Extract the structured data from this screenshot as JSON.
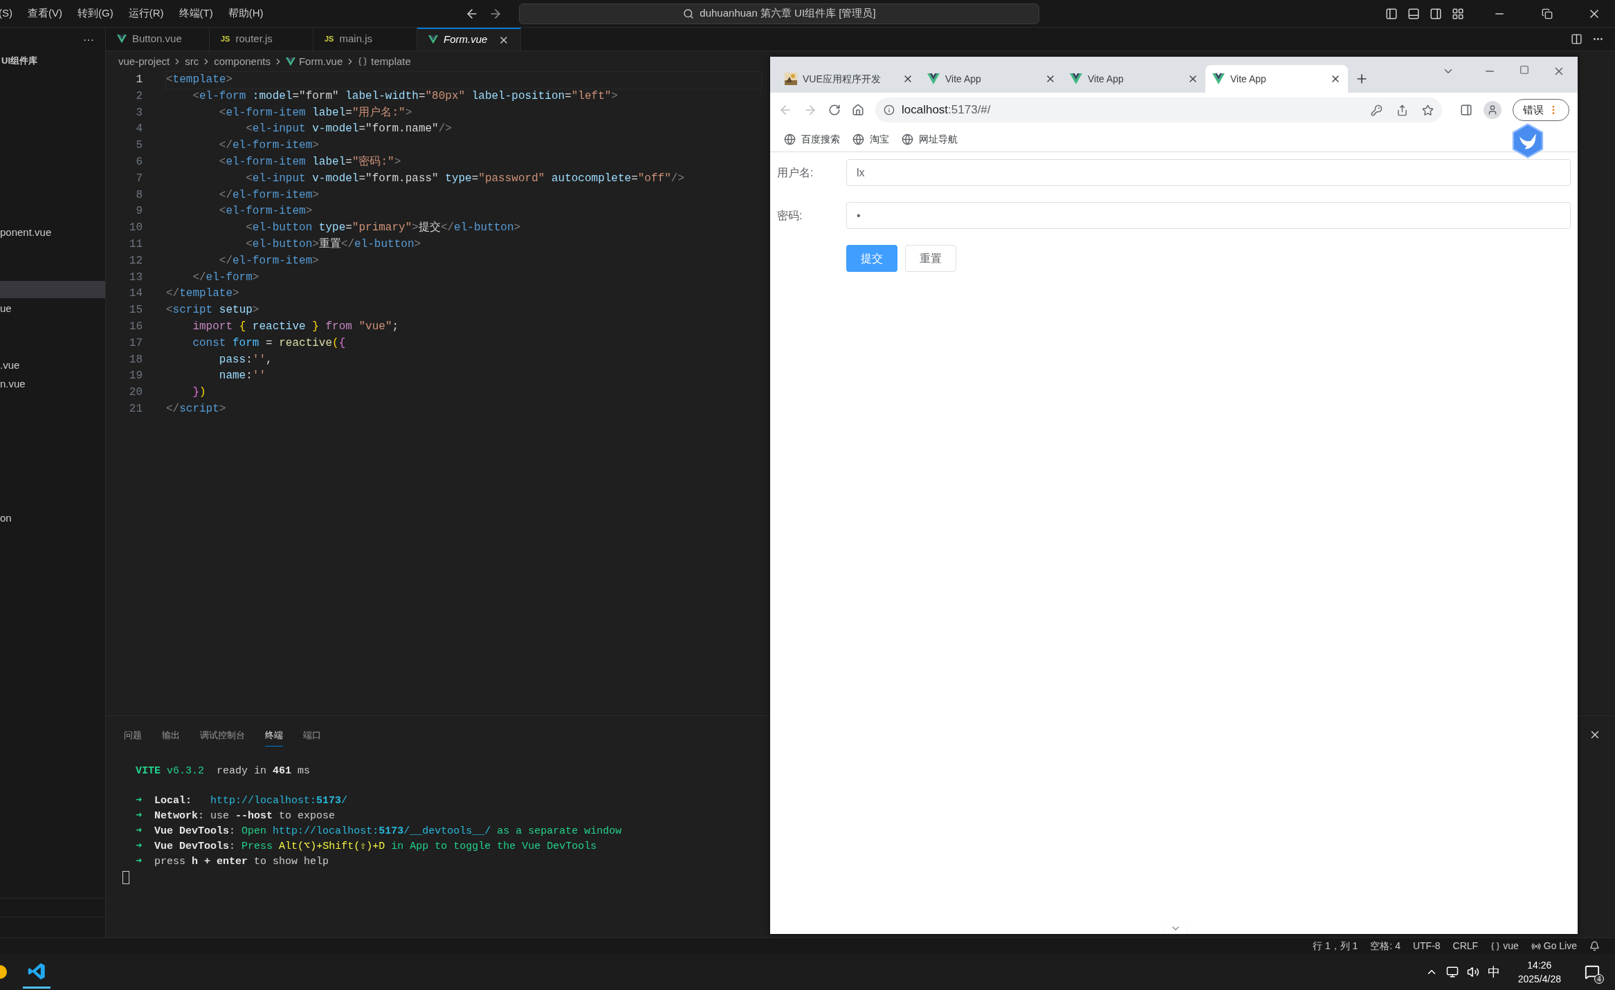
{
  "title_bar": {
    "menus": [
      "(S)",
      "查看(V)",
      "转到(G)",
      "运行(R)",
      "终端(T)",
      "帮助(H)"
    ],
    "search": "duhuanhuan 第六章 UI组件库 [管理员]"
  },
  "sidebar": {
    "more": "···",
    "title": "UI组件库",
    "items": [
      "ponent.vue",
      "ue",
      ".vue",
      "n.vue",
      "on"
    ]
  },
  "editor_tabs": [
    {
      "label": "Button.vue",
      "kind": "vue",
      "selected": false
    },
    {
      "label": "router.js",
      "kind": "js",
      "badge": "JS",
      "selected": false
    },
    {
      "label": "main.js",
      "kind": "js",
      "badge": "JS",
      "selected": false
    },
    {
      "label": "Form.vue",
      "kind": "vue",
      "selected": true
    }
  ],
  "breadcrumb": [
    {
      "label": "vue-project",
      "kind": "folder"
    },
    {
      "label": "src",
      "kind": "folder"
    },
    {
      "label": "components",
      "kind": "folder"
    },
    {
      "label": "Form.vue",
      "kind": "vue"
    },
    {
      "label": "template",
      "kind": "element"
    }
  ],
  "code": [
    {
      "n": "1",
      "current": true,
      "tokens": [
        {
          "kind": "b",
          "text": "<"
        },
        {
          "kind": "tag",
          "text": "template"
        },
        {
          "kind": "b",
          "text": ">"
        }
      ]
    },
    {
      "n": "2",
      "current": false,
      "tokens": [
        {
          "kind": "b",
          "text": "    <"
        },
        {
          "kind": "tag",
          "text": "el-form "
        },
        {
          "kind": "attr",
          "text": ":model"
        },
        {
          "kind": "t",
          "text": "=\"form\" "
        },
        {
          "kind": "attr",
          "text": "label-width"
        },
        {
          "kind": "t",
          "text": "="
        },
        {
          "kind": "str",
          "text": "\"80px\" "
        },
        {
          "kind": "attr",
          "text": "label-position"
        },
        {
          "kind": "t",
          "text": "="
        },
        {
          "kind": "str",
          "text": "\"left\""
        },
        {
          "kind": "b",
          "text": ">"
        }
      ]
    },
    {
      "n": "3",
      "current": false,
      "tokens": [
        {
          "kind": "b",
          "text": "        <"
        },
        {
          "kind": "tag",
          "text": "el-form-item "
        },
        {
          "kind": "attr",
          "text": "label"
        },
        {
          "kind": "t",
          "text": "="
        },
        {
          "kind": "str",
          "text": "\"用户名:\""
        },
        {
          "kind": "b",
          "text": ">"
        }
      ]
    },
    {
      "n": "4",
      "current": false,
      "tokens": [
        {
          "kind": "b",
          "text": "            <"
        },
        {
          "kind": "tag",
          "text": "el-input "
        },
        {
          "kind": "attr",
          "text": "v-model"
        },
        {
          "kind": "t",
          "text": "=\"form.name\""
        },
        {
          "kind": "b",
          "text": "/>"
        }
      ]
    },
    {
      "n": "5",
      "current": false,
      "tokens": [
        {
          "kind": "b",
          "text": "        </"
        },
        {
          "kind": "tag",
          "text": "el-form-item"
        },
        {
          "kind": "b",
          "text": ">"
        }
      ]
    },
    {
      "n": "6",
      "current": false,
      "tokens": [
        {
          "kind": "b",
          "text": "        <"
        },
        {
          "kind": "tag",
          "text": "el-form-item "
        },
        {
          "kind": "attr",
          "text": "label"
        },
        {
          "kind": "t",
          "text": "="
        },
        {
          "kind": "str",
          "text": "\"密码:\""
        },
        {
          "kind": "b",
          "text": ">"
        }
      ]
    },
    {
      "n": "7",
      "current": false,
      "tokens": [
        {
          "kind": "b",
          "text": "            <"
        },
        {
          "kind": "tag",
          "text": "el-input "
        },
        {
          "kind": "attr",
          "text": "v-model"
        },
        {
          "kind": "t",
          "text": "=\"form.pass\" "
        },
        {
          "kind": "attr",
          "text": "type"
        },
        {
          "kind": "t",
          "text": "="
        },
        {
          "kind": "str",
          "text": "\"password\" "
        },
        {
          "kind": "attr",
          "text": "autocomplete"
        },
        {
          "kind": "t",
          "text": "="
        },
        {
          "kind": "str",
          "text": "\"off\""
        },
        {
          "kind": "b",
          "text": "/>"
        }
      ]
    },
    {
      "n": "8",
      "current": false,
      "tokens": [
        {
          "kind": "b",
          "text": "        </"
        },
        {
          "kind": "tag",
          "text": "el-form-item"
        },
        {
          "kind": "b",
          "text": ">"
        }
      ]
    },
    {
      "n": "9",
      "current": false,
      "tokens": [
        {
          "kind": "b",
          "text": "        <"
        },
        {
          "kind": "tag",
          "text": "el-form-item"
        },
        {
          "kind": "b",
          "text": ">"
        }
      ]
    },
    {
      "n": "10",
      "current": false,
      "tokens": [
        {
          "kind": "b",
          "text": "            <"
        },
        {
          "kind": "tag",
          "text": "el-button "
        },
        {
          "kind": "attr",
          "text": "type"
        },
        {
          "kind": "t",
          "text": "="
        },
        {
          "kind": "str",
          "text": "\"primary\""
        },
        {
          "kind": "b",
          "text": ">"
        },
        {
          "kind": "t",
          "text": "提交"
        },
        {
          "kind": "b",
          "text": "</"
        },
        {
          "kind": "tag",
          "text": "el-button"
        },
        {
          "kind": "b",
          "text": ">"
        }
      ]
    },
    {
      "n": "11",
      "current": false,
      "tokens": [
        {
          "kind": "b",
          "text": "            <"
        },
        {
          "kind": "tag",
          "text": "el-button"
        },
        {
          "kind": "b",
          "text": ">"
        },
        {
          "kind": "t",
          "text": "重置"
        },
        {
          "kind": "b",
          "text": "</"
        },
        {
          "kind": "tag",
          "text": "el-button"
        },
        {
          "kind": "b",
          "text": ">"
        }
      ]
    },
    {
      "n": "12",
      "current": false,
      "tokens": [
        {
          "kind": "b",
          "text": "        </"
        },
        {
          "kind": "tag",
          "text": "el-form-item"
        },
        {
          "kind": "b",
          "text": ">"
        }
      ]
    },
    {
      "n": "13",
      "current": false,
      "tokens": [
        {
          "kind": "b",
          "text": "    </"
        },
        {
          "kind": "tag",
          "text": "el-form"
        },
        {
          "kind": "b",
          "text": ">"
        }
      ]
    },
    {
      "n": "14",
      "current": false,
      "tokens": [
        {
          "kind": "b",
          "text": "</"
        },
        {
          "kind": "tag",
          "text": "template"
        },
        {
          "kind": "b",
          "text": ">"
        }
      ]
    },
    {
      "n": "15",
      "current": false,
      "tokens": [
        {
          "kind": "b",
          "text": "<"
        },
        {
          "kind": "tag",
          "text": "script "
        },
        {
          "kind": "attr",
          "text": "setup"
        },
        {
          "kind": "b",
          "text": ">"
        }
      ]
    },
    {
      "n": "16",
      "current": false,
      "tokens": [
        {
          "kind": "kw",
          "text": "    import "
        },
        {
          "kind": "br1",
          "text": "{ "
        },
        {
          "kind": "attr",
          "text": "reactive "
        },
        {
          "kind": "br1",
          "text": "} "
        },
        {
          "kind": "kw",
          "text": "from "
        },
        {
          "kind": "str",
          "text": "\"vue\""
        },
        {
          "kind": "t",
          "text": ";"
        }
      ]
    },
    {
      "n": "17",
      "current": false,
      "tokens": [
        {
          "kind": "decl",
          "text": "    const "
        },
        {
          "kind": "var",
          "text": "form "
        },
        {
          "kind": "t",
          "text": "= "
        },
        {
          "kind": "fn",
          "text": "reactive"
        },
        {
          "kind": "br1",
          "text": "("
        },
        {
          "kind": "br2",
          "text": "{"
        }
      ]
    },
    {
      "n": "18",
      "current": false,
      "tokens": [
        {
          "kind": "attr",
          "text": "        pass"
        },
        {
          "kind": "t",
          "text": ":"
        },
        {
          "kind": "str",
          "text": "''"
        },
        {
          "kind": "t",
          "text": ","
        }
      ]
    },
    {
      "n": "19",
      "current": false,
      "tokens": [
        {
          "kind": "attr",
          "text": "        name"
        },
        {
          "kind": "t",
          "text": ":"
        },
        {
          "kind": "str",
          "text": "''"
        }
      ]
    },
    {
      "n": "20",
      "current": false,
      "tokens": [
        {
          "kind": "br2",
          "text": "    }"
        },
        {
          "kind": "br1",
          "text": ")"
        }
      ]
    },
    {
      "n": "21",
      "current": false,
      "tokens": [
        {
          "kind": "b",
          "text": "</"
        },
        {
          "kind": "tag",
          "text": "script"
        },
        {
          "kind": "b",
          "text": ">"
        }
      ]
    }
  ],
  "panel": {
    "tabs": [
      {
        "label": "问题",
        "selected": false
      },
      {
        "label": "输出",
        "selected": false
      },
      {
        "label": "调试控制台",
        "selected": false
      },
      {
        "label": "终端",
        "selected": true
      },
      {
        "label": "端口",
        "selected": false
      }
    ],
    "terminal": [
      [
        {
          "kind": "vite",
          "text": "VITE "
        },
        {
          "kind": "green",
          "text": "v6.3.2  "
        },
        {
          "kind": "w",
          "text": "ready in "
        },
        {
          "kind": "bold",
          "text": "461"
        },
        {
          "kind": "w",
          "text": " ms"
        }
      ],
      [
        {
          "kind": "arrow",
          "text": "➜  "
        },
        {
          "kind": "bold",
          "text": "Local:   "
        },
        {
          "kind": "link",
          "text": "http://localhost:"
        },
        {
          "kind": "linkbold",
          "text": "5173"
        },
        {
          "kind": "link",
          "text": "/"
        }
      ],
      [
        {
          "kind": "arrow",
          "text": "➜  "
        },
        {
          "kind": "bold",
          "text": "Network"
        },
        {
          "kind": "w",
          "text": ": use "
        },
        {
          "kind": "bold",
          "text": "--host"
        },
        {
          "kind": "w",
          "text": " to expose"
        }
      ],
      [
        {
          "kind": "arrow",
          "text": "➜  "
        },
        {
          "kind": "bold",
          "text": "Vue DevTools"
        },
        {
          "kind": "w",
          "text": ": "
        },
        {
          "kind": "green",
          "text": "Open "
        },
        {
          "kind": "link",
          "text": "http://localhost:"
        },
        {
          "kind": "linkbold",
          "text": "5173"
        },
        {
          "kind": "link",
          "text": "/__devtools__/"
        },
        {
          "kind": "green",
          "text": " as a separate window"
        }
      ],
      [
        {
          "kind": "arrow",
          "text": "➜  "
        },
        {
          "kind": "bold",
          "text": "Vue DevTools"
        },
        {
          "kind": "w",
          "text": ": "
        },
        {
          "kind": "green",
          "text": "Press "
        },
        {
          "kind": "yellow",
          "text": "Alt(⌥)+Shift(⇧)+D"
        },
        {
          "kind": "green",
          "text": " in App to toggle the Vue DevTools"
        }
      ],
      [
        {
          "kind": "arrow",
          "text": "➜  "
        },
        {
          "kind": "w",
          "text": "press "
        },
        {
          "kind": "bold",
          "text": "h + enter"
        },
        {
          "kind": "w",
          "text": " to show help"
        }
      ]
    ]
  },
  "browser": {
    "tabs": [
      {
        "title": "VUE应用程序开发",
        "kind": "site",
        "selected": false
      },
      {
        "title": "Vite App",
        "kind": "vue",
        "selected": false
      },
      {
        "title": "Vite App",
        "kind": "vue",
        "selected": false
      },
      {
        "title": "Vite App",
        "kind": "vue",
        "selected": true
      }
    ],
    "address": {
      "host": "localhost",
      "path": ":5173/#/"
    },
    "bookmarks": [
      "百度搜索",
      "淘宝",
      "网址导航"
    ],
    "profile_button": "错误",
    "form": {
      "fields": [
        {
          "label": "用户名:",
          "value": "lx"
        },
        {
          "label": "密码:",
          "value": "•"
        }
      ],
      "buttons": [
        {
          "label": "提交",
          "kind": "primary"
        },
        {
          "label": "重置",
          "kind": "default"
        }
      ]
    }
  },
  "status_bar": {
    "position": "行 1，列 1",
    "indent": "空格: 4",
    "encoding": "UTF-8",
    "eol": "CRLF",
    "language": "vue",
    "live": "Go Live"
  },
  "taskbar": {
    "ime": "中",
    "time": "14:26",
    "date": "2025/4/28",
    "notifications": "4"
  }
}
